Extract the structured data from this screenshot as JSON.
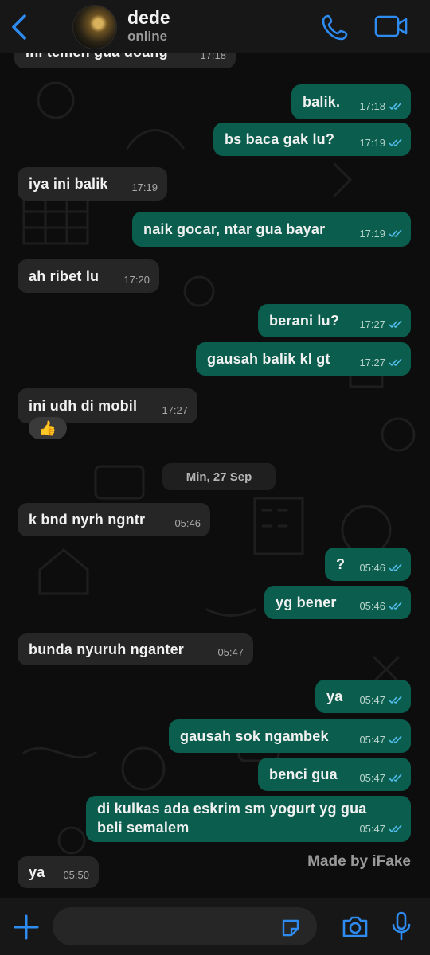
{
  "header": {
    "contact_name": "dede",
    "status": "online"
  },
  "messages": [
    {
      "dir": "in",
      "text": "ini temen gua doang",
      "time": "17:18"
    },
    {
      "dir": "out",
      "text": "balik.",
      "time": "17:18"
    },
    {
      "dir": "out",
      "text": "bs baca gak lu?",
      "time": "17:19"
    },
    {
      "dir": "in",
      "text": "iya ini balik",
      "time": "17:19"
    },
    {
      "dir": "out",
      "text": "naik gocar, ntar gua bayar",
      "time": "17:19"
    },
    {
      "dir": "in",
      "text": "ah ribet lu",
      "time": "17:20"
    },
    {
      "dir": "out",
      "text": "berani lu?",
      "time": "17:27"
    },
    {
      "dir": "out",
      "text": "gausah balik kl gt",
      "time": "17:27"
    },
    {
      "dir": "in",
      "text": "ini udh di mobil",
      "time": "17:27"
    },
    {
      "dir": "in",
      "text": "k bnd nyrh ngntr",
      "time": "05:46"
    },
    {
      "dir": "out",
      "text": "?",
      "time": "05:46"
    },
    {
      "dir": "out",
      "text": "yg bener",
      "time": "05:46"
    },
    {
      "dir": "in",
      "text": "bunda nyuruh nganter",
      "time": "05:47"
    },
    {
      "dir": "out",
      "text": "ya",
      "time": "05:47"
    },
    {
      "dir": "out",
      "text": "gausah sok ngambek",
      "time": "05:47"
    },
    {
      "dir": "out",
      "text": "benci gua",
      "time": "05:47"
    },
    {
      "dir": "out",
      "text_line1": "di kulkas ada eskrim sm yogurt yg gua",
      "text_line2": "beli semalem",
      "time": "05:47"
    },
    {
      "dir": "in",
      "text": "ya",
      "time": "05:50"
    }
  ],
  "reaction": {
    "emoji": "👍",
    "icon": "thumbs-up"
  },
  "date_separator": "Min, 27 Sep",
  "watermark": "Made by iFake",
  "icons": {
    "back": "chevron-left-icon",
    "call": "phone-icon",
    "video": "video-camera-icon",
    "add": "plus-icon",
    "sticker": "sticker-icon",
    "camera": "camera-icon",
    "mic": "microphone-icon"
  },
  "colors": {
    "accent": "#2e8bf0",
    "outgoing_bubble": "#0b5e4e",
    "incoming_bubble": "#262626",
    "read_ticks": "#53bdeb"
  }
}
